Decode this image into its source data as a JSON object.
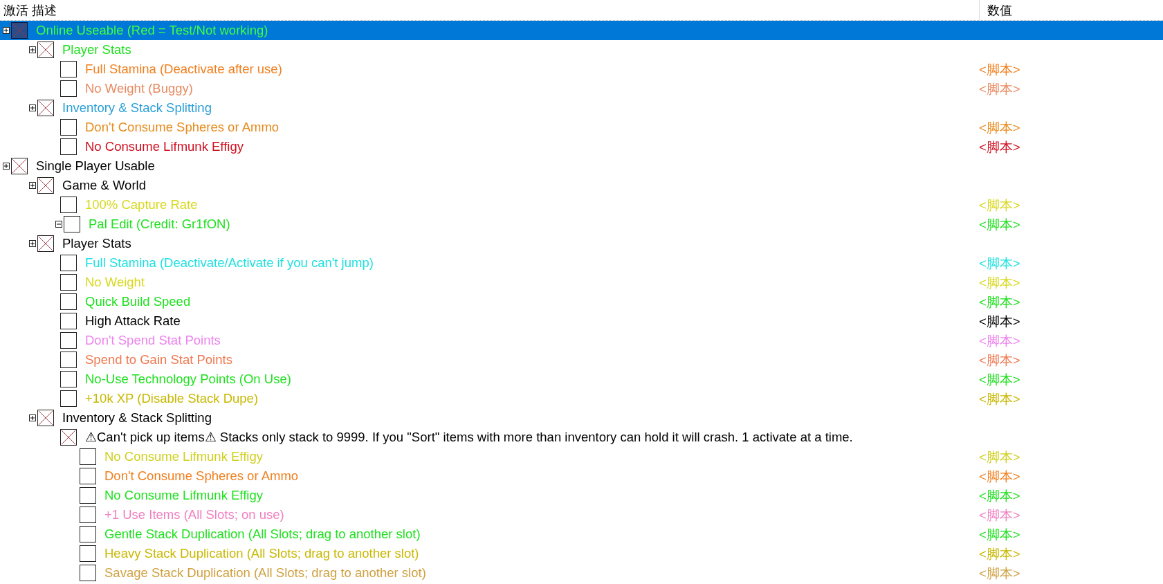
{
  "columns": [
    {
      "label": "激活"
    },
    {
      "label": "描述"
    },
    {
      "label": "数值"
    }
  ],
  "entries": [
    {
      "kind": "group",
      "expanded": false,
      "checked": true,
      "selected": true,
      "description": "Online Useable (Red = Test/Not working)",
      "color": "#40ff40",
      "children": [
        {
          "kind": "group",
          "expanded": false,
          "checked": true,
          "selected": false,
          "description": "Player Stats",
          "color": "#1ee01e",
          "children": [
            {
              "kind": "entry",
              "checked": false,
              "selected": false,
              "description": "Full Stamina (Deactivate after use)",
              "value": "<脚本>",
              "color": "#f08020"
            },
            {
              "kind": "entry",
              "checked": false,
              "selected": false,
              "description": "No Weight (Buggy)",
              "value": "<脚本>",
              "color": "#e88a60"
            }
          ]
        },
        {
          "kind": "group",
          "expanded": false,
          "checked": true,
          "selected": false,
          "description": "Inventory & Stack Splitting",
          "color": "#2a9fd6",
          "children": [
            {
              "kind": "entry",
              "checked": false,
              "selected": false,
              "description": "Don't Consume Spheres or Ammo",
              "value": "<脚本>",
              "color": "#e88a1a"
            },
            {
              "kind": "entry",
              "checked": false,
              "selected": false,
              "description": "No Consume Lifmunk Effigy",
              "value": "<脚本>",
              "color": "#d01020"
            }
          ]
        }
      ]
    },
    {
      "kind": "group",
      "expanded": false,
      "checked": true,
      "selected": false,
      "description": "Single Player Usable",
      "color": "#000000",
      "children": [
        {
          "kind": "group",
          "expanded": false,
          "checked": true,
          "selected": false,
          "description": "Game & World",
          "color": "#000000",
          "children": [
            {
              "kind": "entry",
              "checked": false,
              "selected": false,
              "description": "100% Capture Rate",
              "value": "<脚本>",
              "color": "#d8d820"
            },
            {
              "kind": "group",
              "expanded": true,
              "checked": false,
              "selected": false,
              "description": "Pal Edit (Credit: Gr1fON)",
              "value": "<脚本>",
              "color": "#20e020"
            }
          ]
        },
        {
          "kind": "group",
          "expanded": false,
          "checked": true,
          "selected": false,
          "description": "Player Stats",
          "color": "#000000",
          "children": [
            {
              "kind": "entry",
              "checked": false,
              "selected": false,
              "description": "Full Stamina (Deactivate/Activate if you can't jump)",
              "value": "<脚本>",
              "color": "#20e0e0"
            },
            {
              "kind": "entry",
              "checked": false,
              "selected": false,
              "description": "No Weight",
              "value": "<脚本>",
              "color": "#d8d820"
            },
            {
              "kind": "entry",
              "checked": false,
              "selected": false,
              "description": "Quick Build Speed",
              "value": "<脚本>",
              "color": "#20e020"
            },
            {
              "kind": "entry",
              "checked": false,
              "selected": false,
              "description": "High Attack Rate",
              "value": "<脚本>",
              "color": "#000000"
            },
            {
              "kind": "entry",
              "checked": false,
              "selected": false,
              "description": "Don't Spend Stat Points",
              "value": "<脚本>",
              "color": "#ee82ee"
            },
            {
              "kind": "entry",
              "checked": false,
              "selected": false,
              "description": "Spend to Gain Stat Points",
              "value": "<脚本>",
              "color": "#f07850"
            },
            {
              "kind": "entry",
              "checked": false,
              "selected": false,
              "description": "No-Use Technology Points (On Use)",
              "value": "<脚本>",
              "color": "#20e020"
            },
            {
              "kind": "entry",
              "checked": false,
              "selected": false,
              "description": "+10k XP (Disable Stack Dupe)",
              "value": "<脚本>",
              "color": "#c8b800"
            }
          ]
        },
        {
          "kind": "group",
          "expanded": false,
          "checked": true,
          "selected": false,
          "description": "Inventory & Stack Splitting",
          "color": "#000000",
          "children": [
            {
              "kind": "entry",
              "checked": true,
              "selected": false,
              "description": "⚠Can't pick up items⚠ Stacks only stack to 9999. If you \"Sort\" items with more than inventory can hold it will crash. 1 activate at a time.",
              "color": "#000000",
              "children": [
                {
                  "kind": "entry",
                  "checked": false,
                  "selected": false,
                  "description": "No Consume Lifmunk Effigy",
                  "value": "<脚本>",
                  "color": "#d0d020"
                },
                {
                  "kind": "entry",
                  "checked": false,
                  "selected": false,
                  "description": "Don't Consume Spheres or Ammo",
                  "value": "<脚本>",
                  "color": "#f08020"
                },
                {
                  "kind": "entry",
                  "checked": false,
                  "selected": false,
                  "description": "No Consume Lifmunk Effigy",
                  "value": "<脚本>",
                  "color": "#20e020"
                },
                {
                  "kind": "entry",
                  "checked": false,
                  "selected": false,
                  "description": "+1 Use Items (All Slots; on use)",
                  "value": "<脚本>",
                  "color": "#f080c0"
                },
                {
                  "kind": "entry",
                  "checked": false,
                  "selected": false,
                  "description": "Gentle Stack Duplication (All Slots; drag to another slot)",
                  "value": "<脚本>",
                  "color": "#20e020"
                },
                {
                  "kind": "entry",
                  "checked": false,
                  "selected": false,
                  "description": "Heavy Stack Duplication (All Slots; drag to another slot)",
                  "value": "<脚本>",
                  "color": "#c8b800"
                },
                {
                  "kind": "entry",
                  "checked": false,
                  "selected": false,
                  "description": "Savage Stack Duplication (All Slots; drag to another slot)",
                  "value": "<脚本>",
                  "color": "#d0a040"
                }
              ]
            }
          ]
        }
      ]
    }
  ]
}
